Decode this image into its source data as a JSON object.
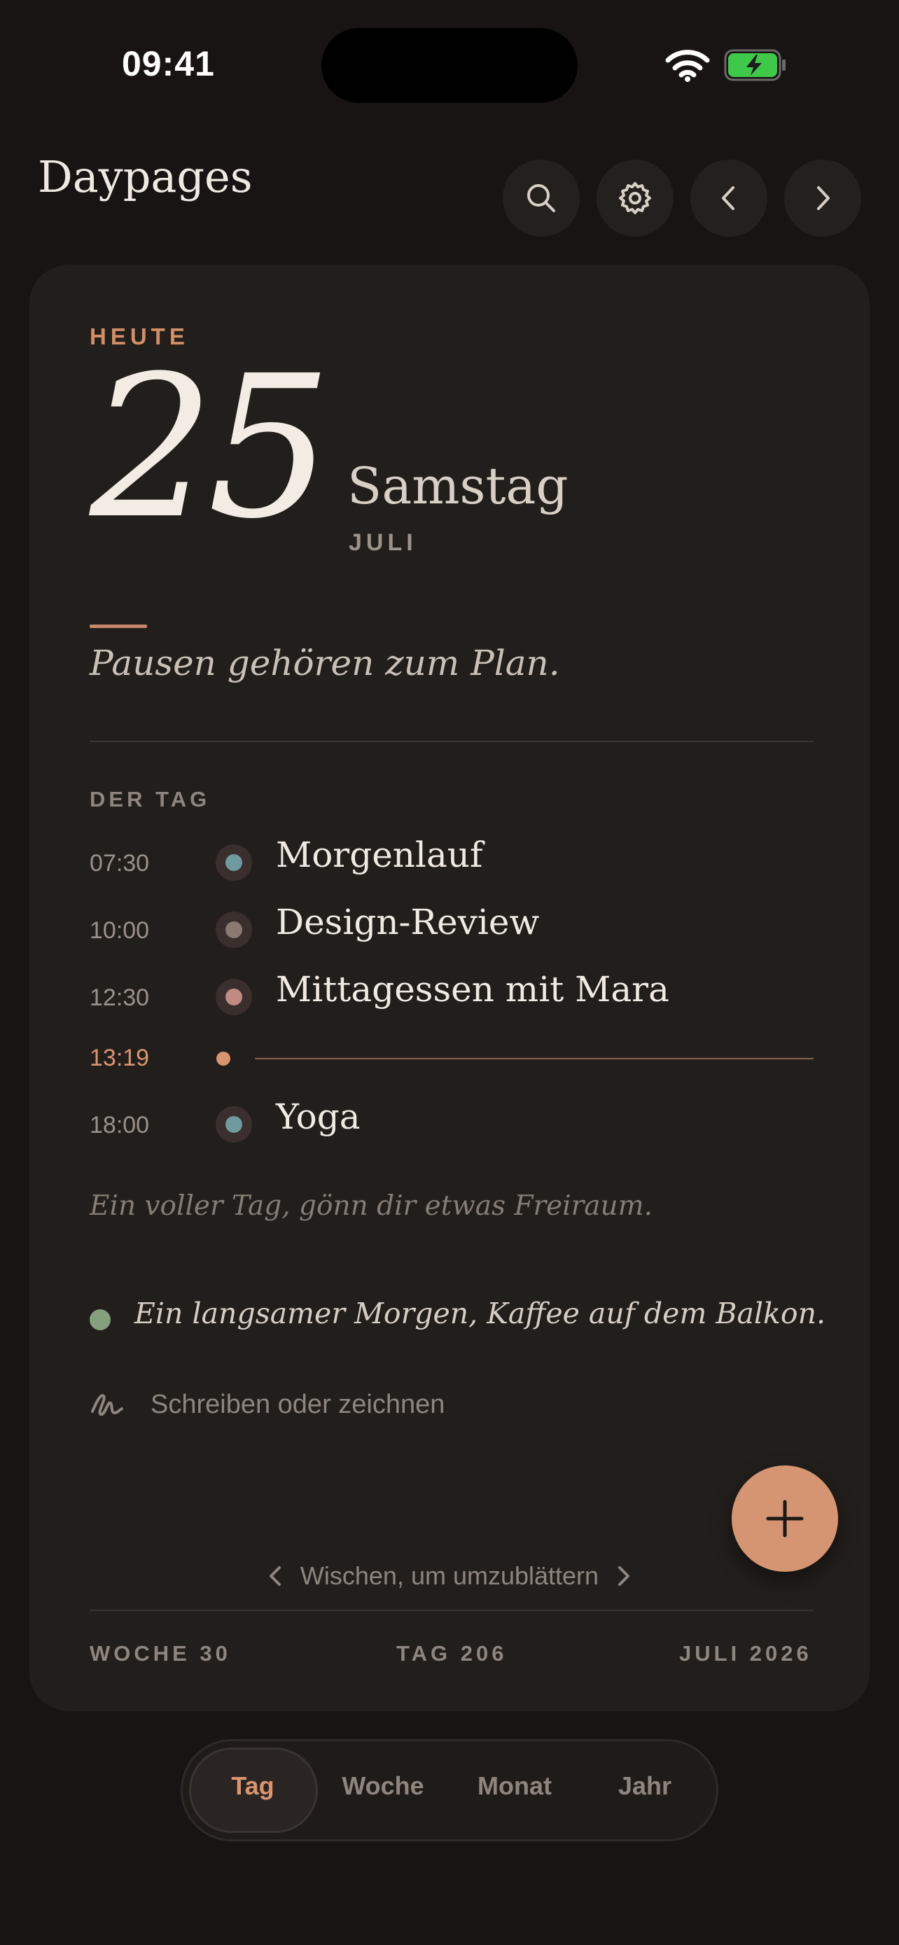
{
  "status_bar": {
    "time": "09:41"
  },
  "header": {
    "title": "Daypages",
    "buttons": [
      "search-icon",
      "gear-icon",
      "chevron-left-icon",
      "chevron-right-icon"
    ]
  },
  "day": {
    "today_label": "HEUTE",
    "number": "25",
    "weekday": "Samstag",
    "month": "JULI",
    "quote": "Pausen gehören zum Plan."
  },
  "schedule": {
    "label": "DER TAG",
    "events": [
      {
        "time": "07:30",
        "title": "Morgenlauf",
        "color": "#6f9aa0"
      },
      {
        "time": "10:00",
        "title": "Design-Review",
        "color": "#8a7a72"
      },
      {
        "time": "12:30",
        "title": "Mittagessen mit Mara",
        "color": "#c18a82"
      },
      {
        "time": "18:00",
        "title": "Yoga",
        "color": "#6f9aa0"
      }
    ],
    "now_time": "13:19",
    "note": "Ein voller Tag, gönn dir etwas Freiraum."
  },
  "journal": {
    "entry": "Ein langsamer Morgen, Kaffee auf dem Balkon.",
    "entry_color": "#84a07c",
    "write_prompt": "Schreiben oder zeichnen"
  },
  "footer": {
    "swipe_hint": "Wischen, um umzublättern",
    "week": "WOCHE 30",
    "day_of_year": "TAG 206",
    "month_year": "JULI 2026"
  },
  "views": {
    "items": [
      "Tag",
      "Woche",
      "Monat",
      "Jahr"
    ],
    "active": "Tag"
  },
  "colors": {
    "accent": "#d59573",
    "background": "#181413",
    "card": "#221e1b"
  }
}
